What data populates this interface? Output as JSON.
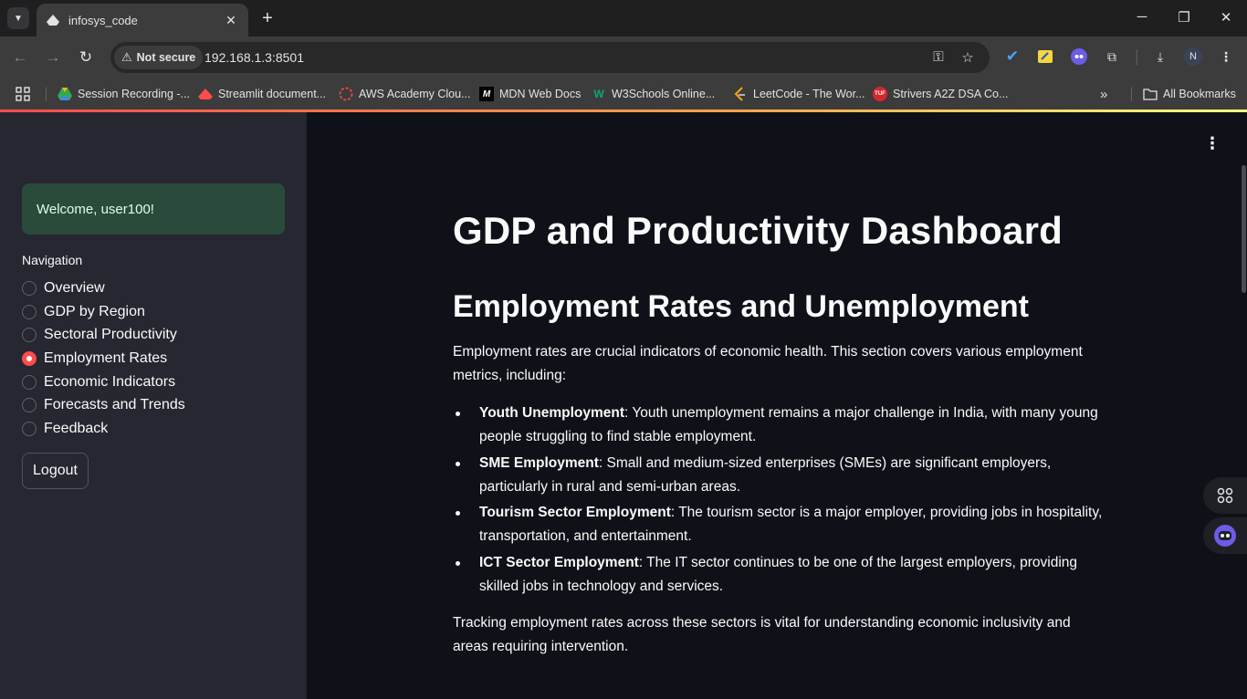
{
  "browser": {
    "tab_title": "infosys_code",
    "security_label": "Not secure",
    "url": "192.168.1.3:8501",
    "bookmarks": [
      "Session Recording -...",
      "Streamlit document...",
      "AWS Academy Clou...",
      "MDN Web Docs",
      "W3Schools Online...",
      "LeetCode - The Wor...",
      "Strivers A2Z DSA Co..."
    ],
    "all_bookmarks": "All Bookmarks",
    "profile_initial": "N"
  },
  "sidebar": {
    "welcome": "Welcome, user100!",
    "nav_label": "Navigation",
    "nav_items": [
      "Overview",
      "GDP by Region",
      "Sectoral Productivity",
      "Employment Rates",
      "Economic Indicators",
      "Forecasts and Trends",
      "Feedback"
    ],
    "selected": "Employment Rates",
    "logout": "Logout"
  },
  "main": {
    "title": "GDP and Productivity Dashboard",
    "section_title": "Employment Rates and Unemployment",
    "intro": "Employment rates are crucial indicators of economic health. This section covers various employment metrics, including:",
    "bullets": [
      {
        "term": "Youth Unemployment",
        "text": ": Youth unemployment remains a major challenge in India, with many young people struggling to find stable employment."
      },
      {
        "term": "SME Employment",
        "text": ": Small and medium-sized enterprises (SMEs) are significant employers, particularly in rural and semi-urban areas."
      },
      {
        "term": "Tourism Sector Employment",
        "text": ": The tourism sector is a major employer, providing jobs in hospitality, transportation, and entertainment."
      },
      {
        "term": "ICT Sector Employment",
        "text": ": The IT sector continues to be one of the largest employers, providing skilled jobs in technology and services."
      }
    ],
    "outro": "Tracking employment rates across these sectors is vital for understanding economic inclusivity and areas requiring intervention."
  },
  "colors": {
    "accent": "#ff4b4b",
    "sidebar_bg": "#262730",
    "main_bg": "#0e1117",
    "welcome_bg": "#2a4b3b"
  }
}
